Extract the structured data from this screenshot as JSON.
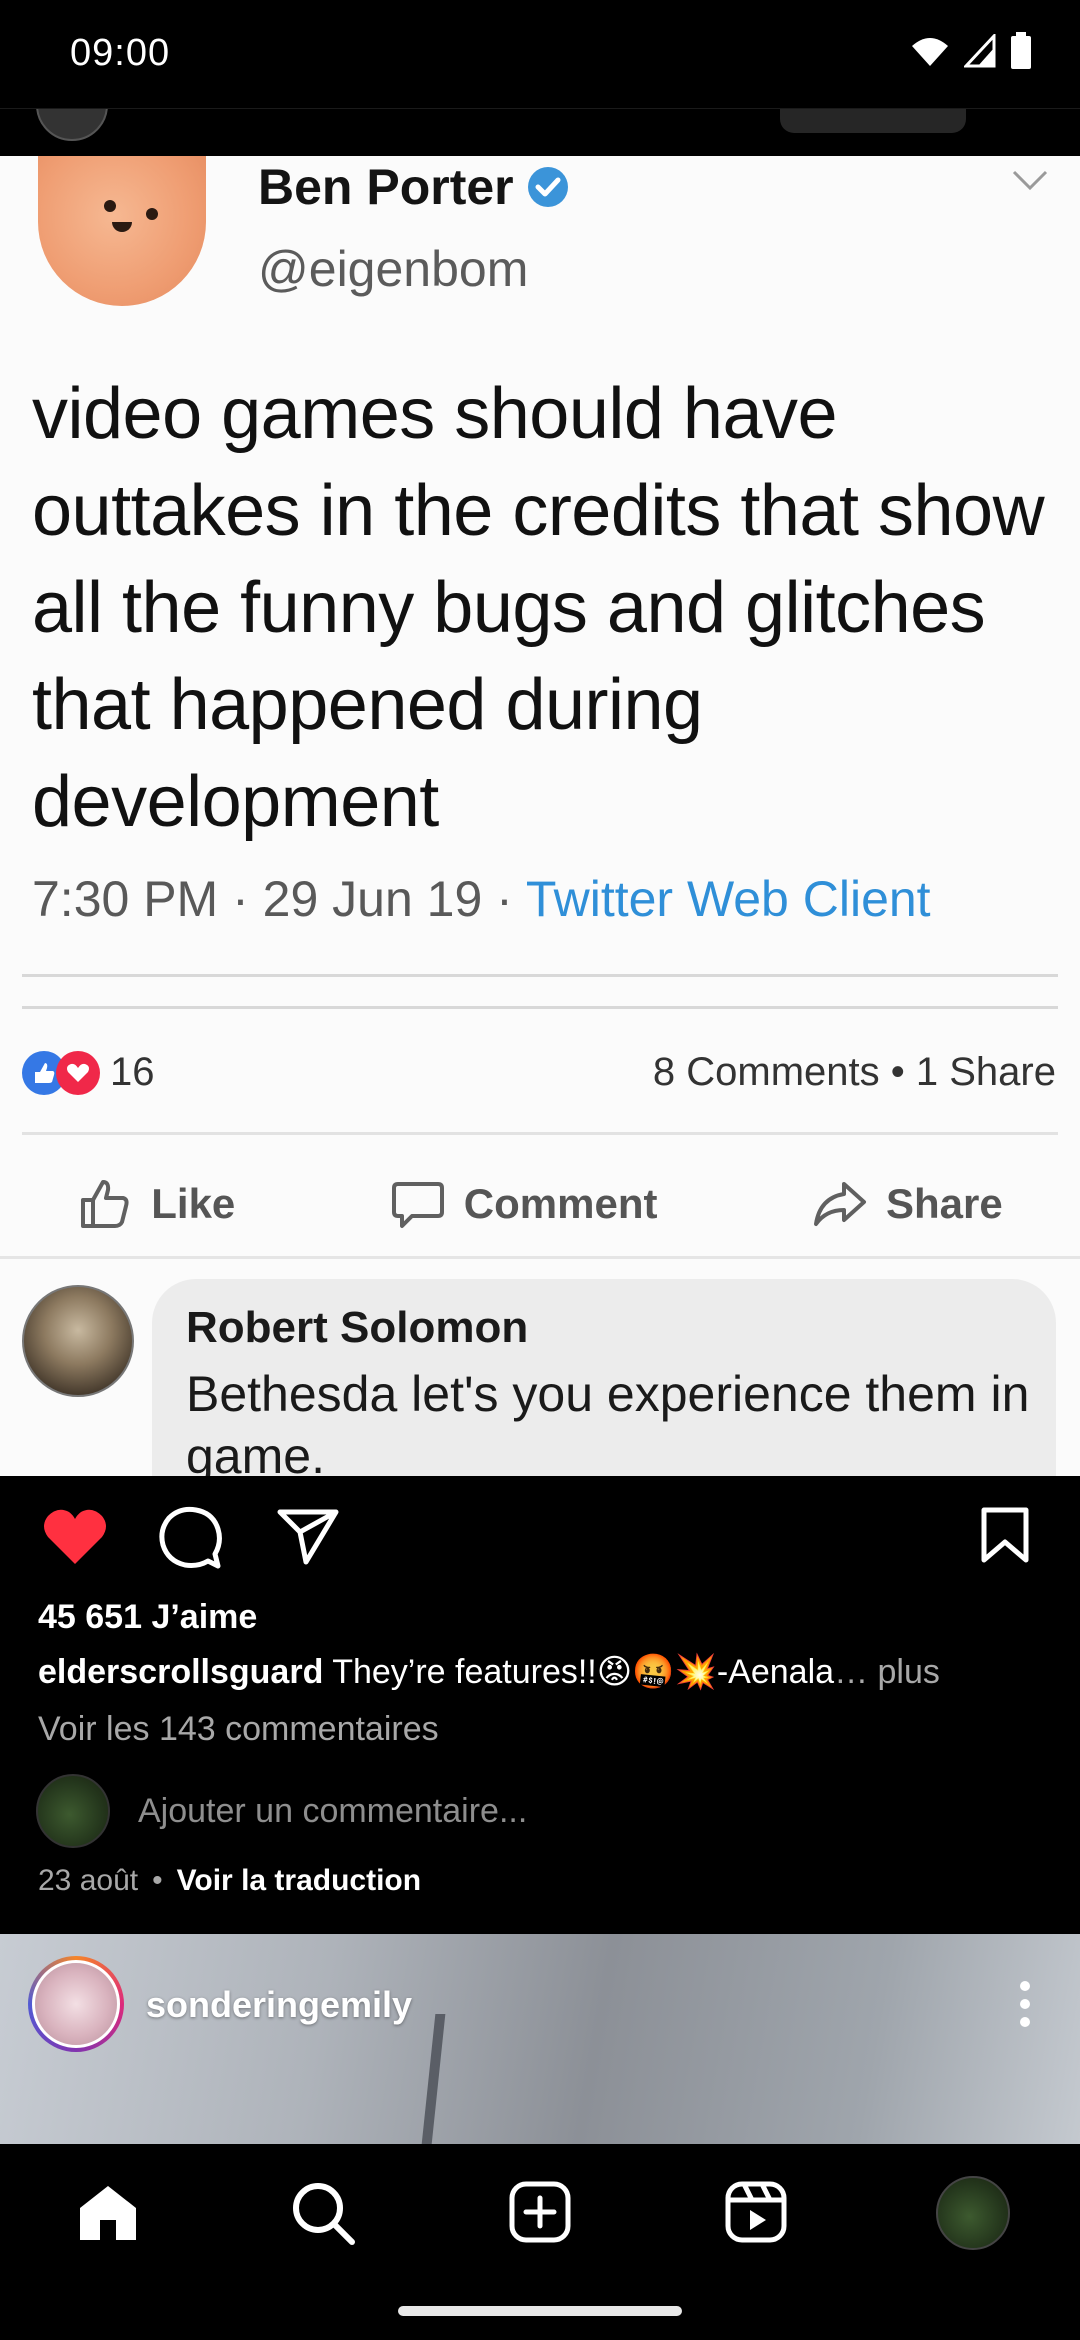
{
  "status_bar": {
    "time": "09:00"
  },
  "tweet": {
    "name": "Ben Porter",
    "handle": "@eigenbom",
    "text": "video games should have outtakes in the credits that show all the funny bugs and glitches that happened during development",
    "time": "7:30 PM · 29 Jun 19 · ",
    "client": "Twitter Web Client"
  },
  "fb": {
    "reaction_count": "16",
    "comments_shares": "8 Comments • 1 Share",
    "actions": {
      "like": "Like",
      "comment": "Comment",
      "share": "Share"
    },
    "comment": {
      "author": "Robert Solomon",
      "text": "Bethesda let's you experience them in game."
    }
  },
  "post": {
    "likes": "45 651 J’aime",
    "username": "elderscrollsguard",
    "caption": "They’re features!!😡🤬💥-Aenala",
    "more": "… plus",
    "view_comments": "Voir les 143 commentaires",
    "add_comment_placeholder": "Ajouter un commentaire...",
    "date": "23 août",
    "separator": "•",
    "translation": "Voir la traduction"
  },
  "next_post": {
    "username": "sonderingemily"
  },
  "colors": {
    "like_red": "#ff3040",
    "link_blue": "#2f8fd8",
    "verified_blue": "#3b94d9"
  }
}
